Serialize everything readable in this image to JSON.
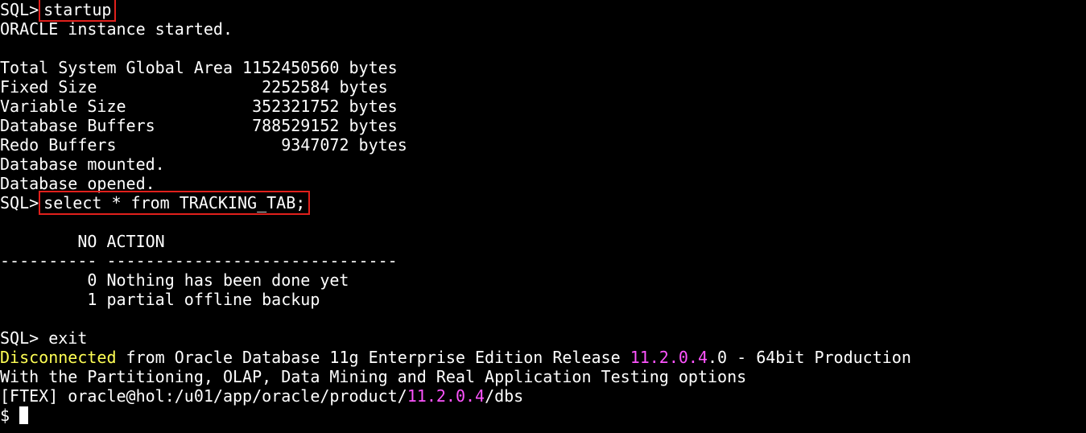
{
  "terminal": {
    "prompt": "SQL>",
    "startup_cmd": "startup",
    "instance_started": "ORACLE instance started.",
    "sga": [
      {
        "label": "Total System Global Area",
        "value": "1152450560",
        "unit": "bytes"
      },
      {
        "label": "Fixed Size",
        "value": "2252584",
        "unit": "bytes"
      },
      {
        "label": "Variable Size",
        "value": "352321752",
        "unit": "bytes"
      },
      {
        "label": "Database Buffers",
        "value": "788529152",
        "unit": "bytes"
      },
      {
        "label": "Redo Buffers",
        "value": "9347072",
        "unit": "bytes"
      }
    ],
    "mounted": "Database mounted.",
    "opened": "Database opened.",
    "select_cmd": "select * from TRACKING_TAB;",
    "query_header": "        NO ACTION",
    "query_sep": "---------- ------------------------------",
    "rows": [
      "         0 Nothing has been done yet",
      "         1 partial offline backup"
    ],
    "exit_cmd": "exit",
    "disconnect_yellow": "Disconnected",
    "disconnect_mid": " from Oracle Database 11g Enterprise Edition Release ",
    "disconnect_version": "11.2.0.4",
    "disconnect_tail": ".0 - 64bit Production",
    "options_line": "With the Partitioning, OLAP, Data Mining and Real Application Testing options",
    "shell_prefix": "[FTEX] oracle@hol:/u01/app/oracle/product/",
    "shell_version": "11.2.0.4",
    "shell_suffix": "/dbs",
    "shell_prompt": "$"
  },
  "colors": {
    "background": "#000000",
    "text": "#ffffff",
    "highlight_box": "#e0201c",
    "yellow": "#ffff54",
    "magenta": "#ff54ff"
  }
}
